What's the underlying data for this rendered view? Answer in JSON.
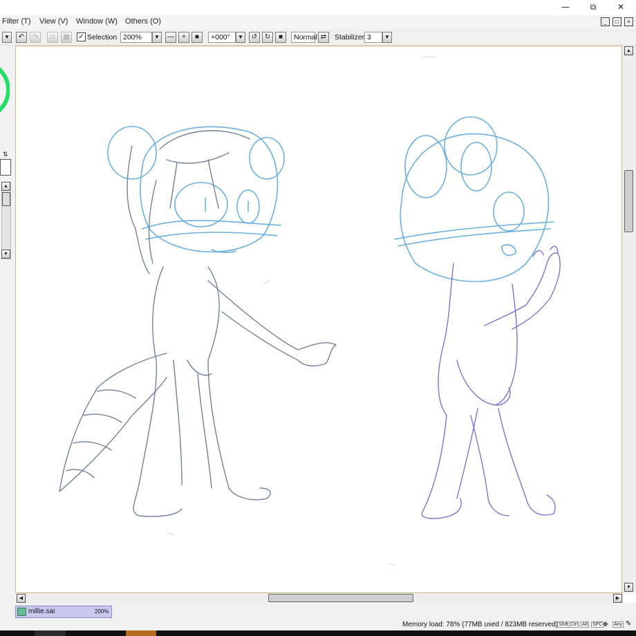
{
  "menu": {
    "items": [
      "Filter (T)",
      "View (V)",
      "Window (W)",
      "Others (O)"
    ]
  },
  "titlebar": {
    "minimize_icon": "minimize-icon",
    "restore_icon": "restore-icon",
    "close_icon": "close-icon"
  },
  "toolbar": {
    "selection_label": "Selection",
    "selection_checked": true,
    "zoom": "200%",
    "rotation": "+000°",
    "blend_mode": "Normal",
    "stabilizer_label": "Stabilizer",
    "stabilizer_value": "3"
  },
  "file_tab": {
    "name": "millie.sai",
    "zoom": "200%"
  },
  "status": {
    "memory": "Memory load: 78% (77MB used / 823MB reserved)",
    "modifier_keys": [
      "Shift",
      "Ctrl",
      "Alt",
      "SPC",
      "Any"
    ]
  },
  "colors": {
    "menubar": "#f5f5f5",
    "canvas_border": "#d9b77a",
    "file_tab": "#c8c8f0",
    "sketch_blue": "#5aa7e0",
    "sketch_gray": "#5a6a88",
    "sketch_purple": "#6a5acd",
    "color_wheel": "#22dd66"
  }
}
